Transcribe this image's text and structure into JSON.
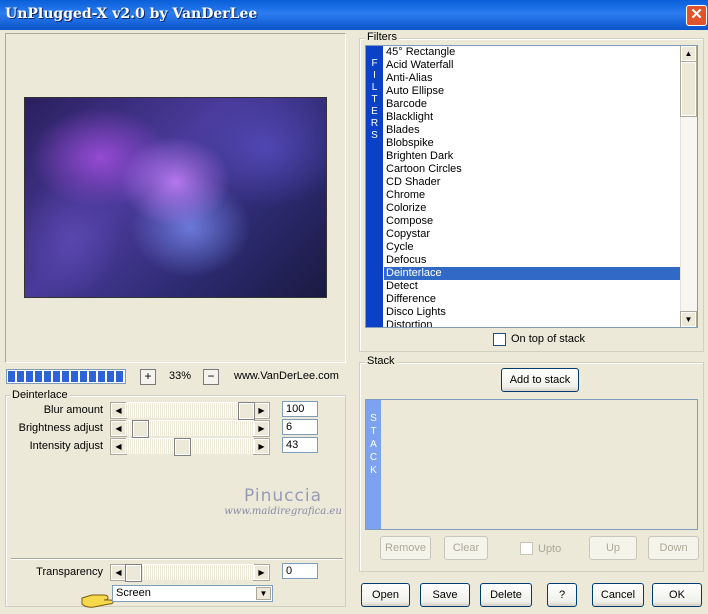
{
  "window": {
    "title": "UnPlugged-X v2.0 by VanDerLee",
    "close_glyph": "✕"
  },
  "preview": {
    "zoom_in": "+",
    "zoom_out": "−",
    "zoom_value": "33%",
    "url": "www.VanDerLee.com",
    "progress_percent": 100
  },
  "filter_group": {
    "label": "Deinterlace",
    "params": [
      {
        "label": "Blur amount",
        "value": "100",
        "level": 1.0
      },
      {
        "label": "Brightness adjust",
        "value": "6",
        "level": 0.06
      },
      {
        "label": "Intensity adjust",
        "value": "43",
        "level": 0.43
      }
    ]
  },
  "watermark": {
    "name": "Pinuccia",
    "site": "www.maidiregrafica.eu"
  },
  "transparency": {
    "label": "Transparency",
    "value": "0",
    "level": 0
  },
  "blend_mode": {
    "value": "Screen"
  },
  "filters": {
    "label": "Filters",
    "bar_text": "FILTERS",
    "items": [
      "45° Rectangle",
      "Acid Waterfall",
      "Anti-Alias",
      "Auto Ellipse",
      "Barcode",
      "Blacklight",
      "Blades",
      "Blobspike",
      "Brighten Dark",
      "Cartoon Circles",
      "CD Shader",
      "Chrome",
      "Colorize",
      "Compose",
      "Copystar",
      "Cycle",
      "Defocus",
      "Deinterlace",
      "Detect",
      "Difference",
      "Disco Lights",
      "Distortion"
    ],
    "selected": "Deinterlace",
    "on_top_label": "On top of stack"
  },
  "stack": {
    "label": "Stack",
    "add_button": "Add to stack",
    "bar_text": "STACK",
    "remove": "Remove",
    "clear": "Clear",
    "upto": "Upto",
    "up": "Up",
    "down": "Down"
  },
  "buttons": {
    "open": "Open",
    "save": "Save",
    "delete": "Delete",
    "help": "?",
    "cancel": "Cancel",
    "ok": "OK"
  },
  "colors": {
    "title_bar": "#0a5fd8",
    "selection": "#3169c6",
    "filter_bar": "#0a41c8",
    "stack_bar": "#7da2ef",
    "progress": "#2d63d6"
  }
}
